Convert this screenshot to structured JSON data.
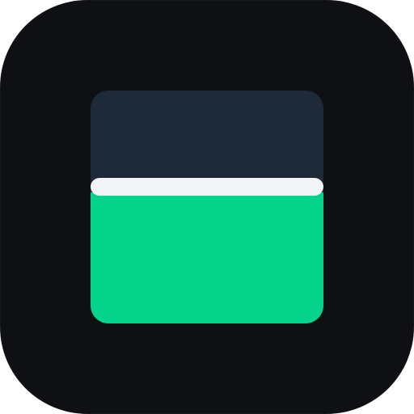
{
  "icon": {
    "name": "app-icon",
    "colors": {
      "background": "#0f1014",
      "panel_top": "#1e2a3a",
      "divider_bar": "#f3f4f6",
      "panel_bottom": "#03d38b"
    },
    "glyph": {
      "icon_name": "card-split-icon",
      "fill_level": 0.57
    }
  }
}
